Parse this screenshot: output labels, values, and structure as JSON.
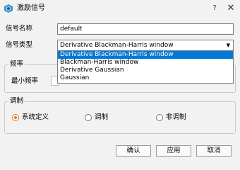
{
  "window": {
    "title": "激励信号",
    "help_label": "?",
    "close_label": "✕"
  },
  "form": {
    "name_label": "信号名称",
    "name_value": "default",
    "type_label": "信号类型",
    "type_value": "Derivative Blackman-Harris window",
    "type_options": [
      "Derivative Blackman-Harris window",
      "Blackman-Harris window",
      "Derivative Gaussian",
      "Gaussian"
    ]
  },
  "frequency": {
    "group_title": "频率",
    "min_label": "最小频率"
  },
  "modulation": {
    "group_title": "调制",
    "options": [
      {
        "label": "系统定义",
        "checked": true
      },
      {
        "label": "调制",
        "checked": false
      },
      {
        "label": "非调制",
        "checked": false
      }
    ]
  },
  "buttons": {
    "ok": "确认",
    "apply": "应用",
    "cancel": "取消"
  },
  "colors": {
    "selection": "#0078d7",
    "radio_accent": "#e87722"
  }
}
